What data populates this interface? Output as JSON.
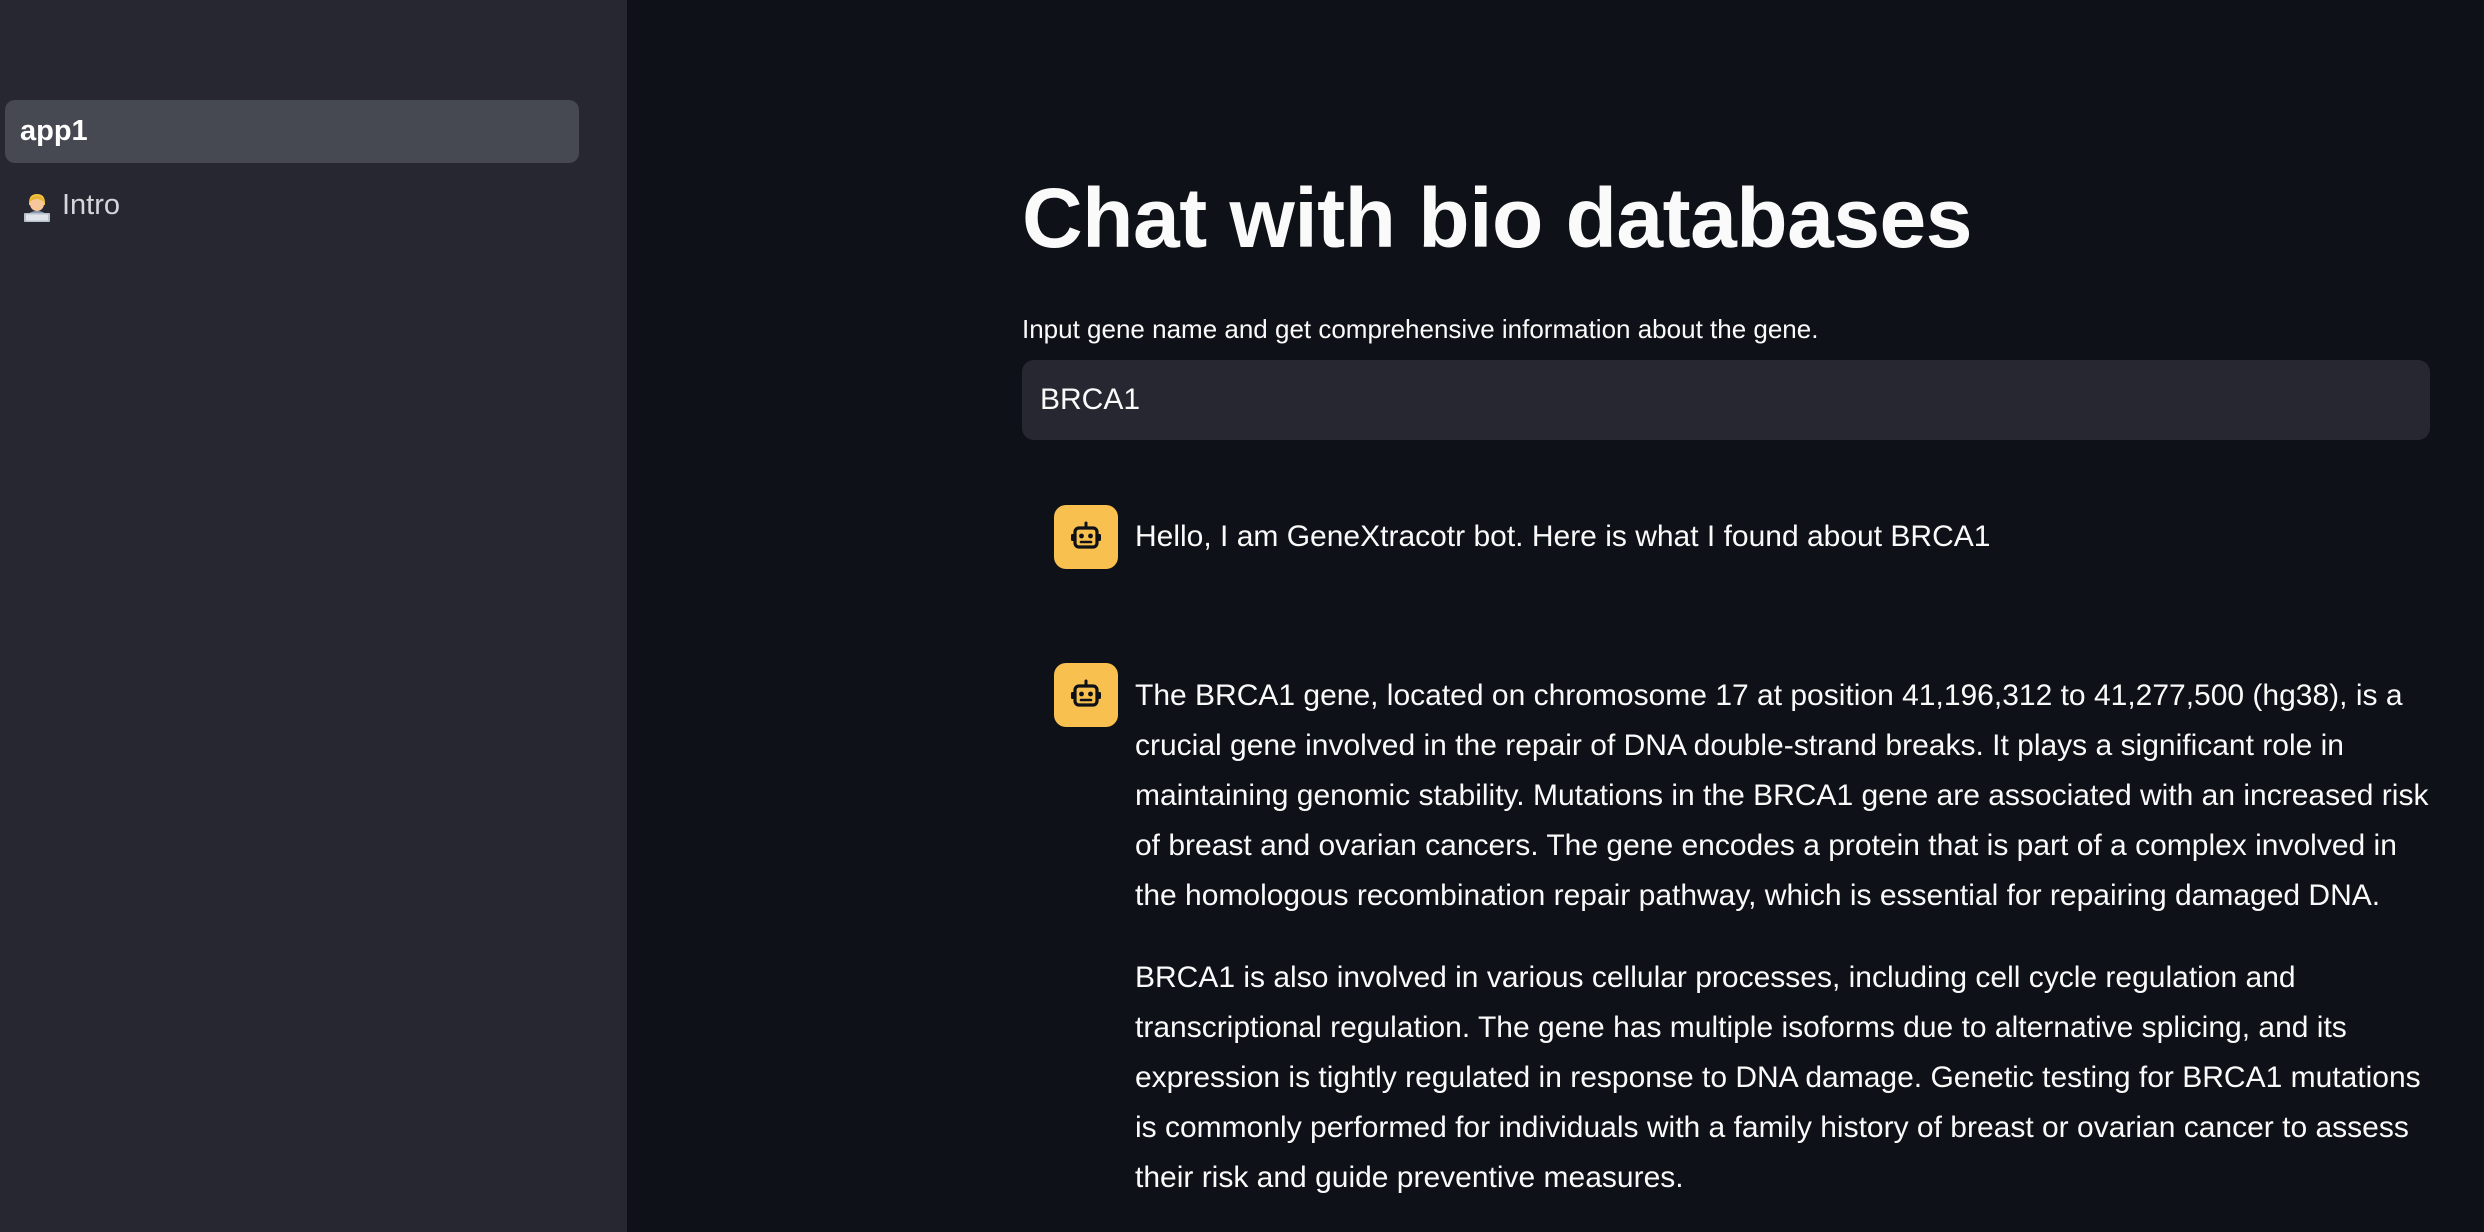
{
  "sidebar": {
    "items": [
      {
        "label": "app1",
        "icon": "",
        "active": true
      },
      {
        "label": "Intro",
        "icon": "person-at-laptop-emoji-icon",
        "active": false
      }
    ]
  },
  "main": {
    "title": "Chat with bio databases",
    "input_label": "Input gene name and get comprehensive information about the gene.",
    "input_value": "BRCA1",
    "messages": [
      {
        "avatar_icon": "robot-icon",
        "paragraphs": [
          "Hello, I am GeneXtracotr bot. Here is what I found about BRCA1"
        ]
      },
      {
        "avatar_icon": "robot-icon",
        "paragraphs": [
          "The BRCA1 gene, located on chromosome 17 at position 41,196,312 to 41,277,500 (hg38), is a crucial gene involved in the repair of DNA double-strand breaks. It plays a significant role in maintaining genomic stability. Mutations in the BRCA1 gene are associated with an increased risk of breast and ovarian cancers. The gene encodes a protein that is part of a complex involved in the homologous recombination repair pathway, which is essential for repairing damaged DNA.",
          "BRCA1 is also involved in various cellular processes, including cell cycle regulation and transcriptional regulation. The gene has multiple isoforms due to alternative splicing, and its expression is tightly regulated in response to DNA damage. Genetic testing for BRCA1 mutations is commonly performed for individuals with a family history of breast or ovarian cancer to assess their risk and guide preventive measures."
        ]
      }
    ]
  },
  "colors": {
    "background": "#0e1117",
    "sidebar": "#262730",
    "sidebar_active": "#464852",
    "input_bg": "#262730",
    "avatar": "#f8c04e",
    "text": "#fafafa"
  }
}
